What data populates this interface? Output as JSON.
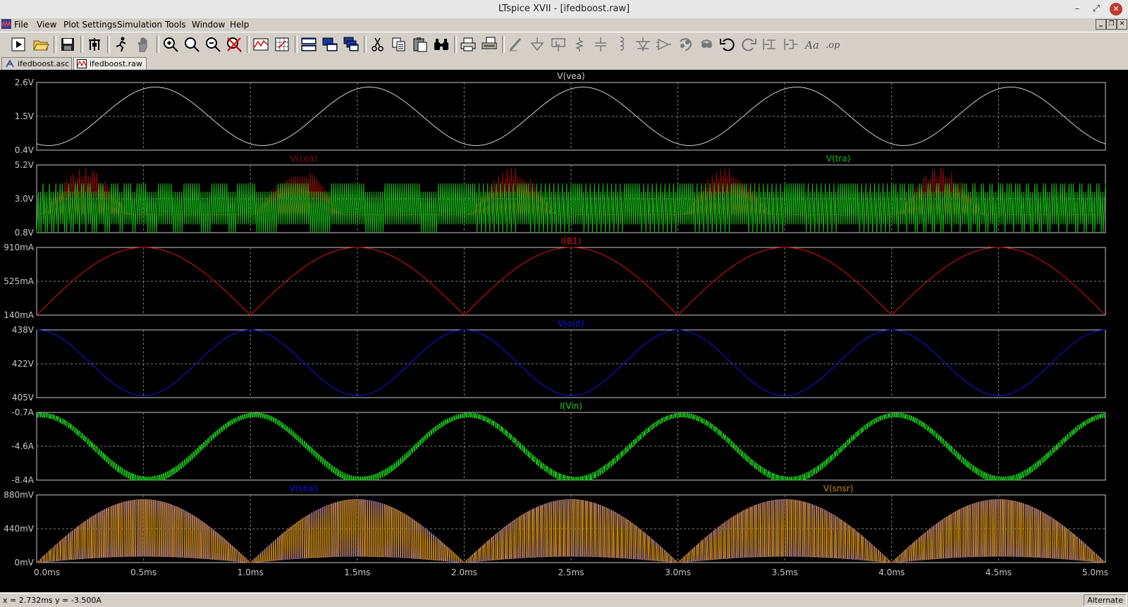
{
  "window": {
    "title": "LTspice XVII - [ifedboost.raw]",
    "minimize": "–",
    "maximize": "⤢",
    "close": "✕"
  },
  "menu": {
    "items": [
      "File",
      "View",
      "Plot Settings",
      "Simulation",
      "Tools",
      "Window",
      "Help"
    ],
    "mdi": [
      "‗",
      "❐",
      "✕"
    ]
  },
  "toolbar": {
    "icons": [
      "run-icon",
      "open-icon",
      "save-icon",
      "control-panel-icon",
      "run-man-icon",
      "halt-hand-icon",
      "zoom-in-icon",
      "zoom-fit-icon",
      "zoom-out-icon",
      "zoom-cancel-icon",
      "autorange-icon",
      "grid-icon",
      "tile-horizontal-icon",
      "tile-vertical-icon",
      "cascade-icon",
      "cut-icon",
      "copy-icon",
      "paste-icon",
      "find-icon",
      "print-icon",
      "print-setup-icon",
      "wire-icon",
      "ground-icon",
      "label-net-icon",
      "resistor-icon",
      "capacitor-icon",
      "inductor-icon",
      "diode-icon",
      "component-icon",
      "rotate-icon",
      "mirror-icon",
      "undo-icon",
      "redo-icon",
      "move-icon",
      "drag-icon",
      "text-icon",
      "spice-directive-icon"
    ]
  },
  "tabs": [
    {
      "label": "ifedboost.asc",
      "icon": "schematic-icon",
      "active": false
    },
    {
      "label": "ifedboost.raw",
      "icon": "waveform-icon",
      "active": true
    }
  ],
  "colors": {
    "grid": "#808080",
    "frame": "#c8c8c8",
    "axis_text": "#c8c8c8",
    "gray": "#d0d0d0",
    "red": "#e01010",
    "darkred": "#8a0c0c",
    "green": "#18b818",
    "blue": "#1414e6",
    "orange": "#c88800",
    "lime": "#1ed81e"
  },
  "chart_data": {
    "type": "line",
    "x_axis": {
      "ticks": [
        "0.0ms",
        "0.5ms",
        "1.0ms",
        "1.5ms",
        "2.0ms",
        "2.5ms",
        "3.0ms",
        "3.5ms",
        "4.0ms",
        "4.5ms",
        "5.0ms"
      ],
      "range": [
        0,
        5
      ],
      "unit": "ms"
    },
    "panes": [
      {
        "traces": [
          {
            "name": "V(vea)",
            "color": "#d0d0d0",
            "kind": "sine",
            "min": 0.55,
            "max": 2.45,
            "label_pos": "center"
          }
        ],
        "yticks": [
          "2.6V",
          "1.5V",
          "0.4V"
        ],
        "ylim": [
          0.4,
          2.6
        ]
      },
      {
        "traces": [
          {
            "name": "V(cea)",
            "color": "#8a0c0c",
            "kind": "cea",
            "min": 1.2,
            "max": 5.0,
            "label_pos": "left"
          },
          {
            "name": "V(tra)",
            "color": "#18b818",
            "kind": "ramp",
            "min": 0.8,
            "max": 4.0,
            "label_pos": "right"
          }
        ],
        "yticks": [
          "5.2V",
          "3.0V",
          "0.8V"
        ],
        "ylim": [
          0.8,
          5.2
        ]
      },
      {
        "traces": [
          {
            "name": "I(B1)",
            "color": "#e01010",
            "kind": "abs_sine",
            "min": 0.14,
            "max": 0.91,
            "label_pos": "center"
          }
        ],
        "yticks": [
          "910mA",
          "525mA",
          "140mA"
        ],
        "ylim": [
          0.14,
          0.91
        ]
      },
      {
        "traces": [
          {
            "name": "V(out)",
            "color": "#1414e6",
            "kind": "vout",
            "min": 406,
            "max": 438,
            "label_pos": "center"
          }
        ],
        "yticks": [
          "438V",
          "422V",
          "405V"
        ],
        "ylim": [
          405,
          438
        ]
      },
      {
        "traces": [
          {
            "name": "I(Vin)",
            "color": "#1ed81e",
            "kind": "iin",
            "min": -8.4,
            "max": -1.0,
            "label_pos": "center"
          }
        ],
        "yticks": [
          "-0.7A",
          "-4.6A",
          "-8.4A"
        ],
        "ylim": [
          -8.4,
          -0.7
        ]
      },
      {
        "traces": [
          {
            "name": "V(snsl)",
            "color": "#1414e6",
            "kind": "sns",
            "min": 0,
            "max": 0.82,
            "label_pos": "left"
          },
          {
            "name": "V(snsr)",
            "color": "#c88800",
            "kind": "sns2",
            "min": 0,
            "max": 0.82,
            "label_pos": "right"
          }
        ],
        "yticks": [
          "880mV",
          "440mV",
          "0mV"
        ],
        "ylim": [
          0,
          0.88
        ]
      }
    ]
  },
  "status": {
    "cursor": "x = 2.732ms    y = -3.500A",
    "mode": "Alternate"
  }
}
